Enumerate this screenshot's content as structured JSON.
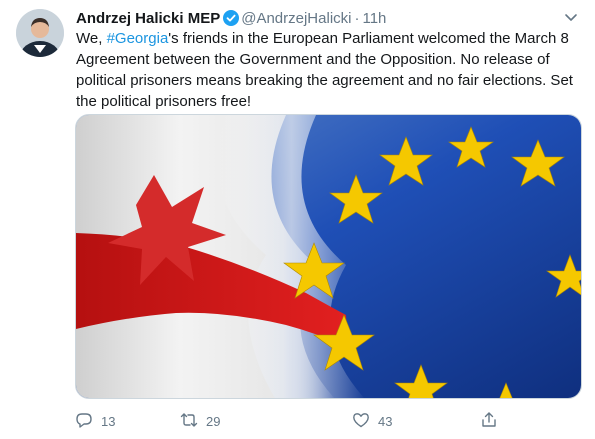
{
  "tweet": {
    "author_name": "Andrzej Halicki MEP",
    "handle": "@AndrzejHalicki",
    "separator": "·",
    "time": "11h",
    "text_before": "We, ",
    "hashtag": "#Georgia",
    "text_after": "'s friends in the European Parliament welcomed the March 8 Agreement between the Government and the Opposition. No release of political prisoners means breaking the agreement and no fair elections. Set the political prisoners free!"
  },
  "actions": {
    "replies": "13",
    "retweets": "29",
    "likes": "43"
  },
  "colors": {
    "link": "#1b95e0",
    "eu_blue": "#1f4fb6",
    "eu_star": "#f5c800",
    "georgia_red": "#d11a1a"
  },
  "icons": [
    "verified-badge-icon",
    "chevron-down-icon",
    "reply-icon",
    "retweet-icon",
    "like-icon",
    "share-icon"
  ]
}
